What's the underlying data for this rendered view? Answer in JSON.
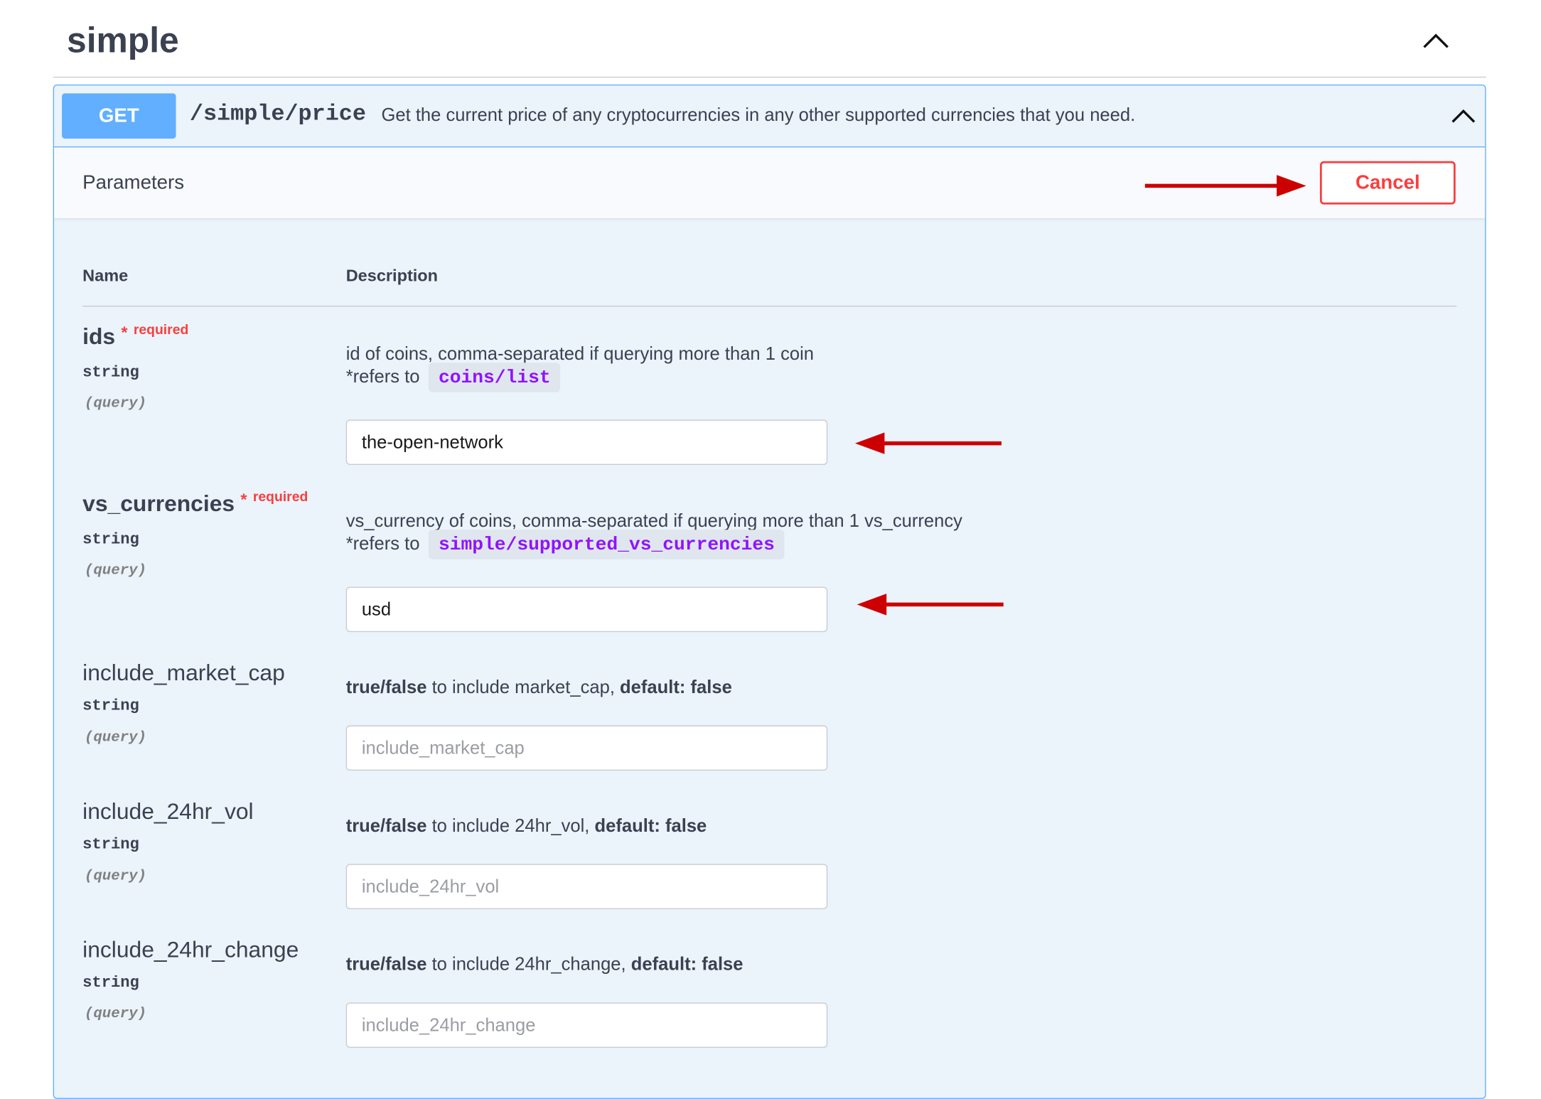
{
  "tag": {
    "title": "simple",
    "toggle_icon": "chevron-up-icon"
  },
  "operation": {
    "method": "GET",
    "path": "/simple/price",
    "summary": "Get the current price of any cryptocurrencies in any other supported currencies that you need.",
    "toggle_icon": "chevron-up-icon",
    "color": "#61affe"
  },
  "parameters_section": {
    "title": "Parameters",
    "cancel_label": "Cancel",
    "cancel_color": "#f93e3e"
  },
  "table": {
    "name_header": "Name",
    "description_header": "Description"
  },
  "params": [
    {
      "name": "ids",
      "required_star": "*",
      "required_label": "required",
      "type": "string",
      "in": "(query)",
      "description": "id of coins, comma-separated if querying more than 1 coin",
      "refers_prefix": "*refers to",
      "refers_link": "coins/list",
      "value": "the-open-network"
    },
    {
      "name": "vs_currencies",
      "required_star": "*",
      "required_label": "required",
      "type": "string",
      "in": "(query)",
      "description": "vs_currency of coins, comma-separated if querying more than 1 vs_currency",
      "refers_prefix": "*refers to",
      "refers_link": "simple/supported_vs_currencies",
      "value": "usd"
    },
    {
      "name": "include_market_cap",
      "type": "string",
      "in": "(query)",
      "desc_bold1": "true/false",
      "desc_mid": " to include market_cap, ",
      "desc_bold2": "default: false",
      "placeholder": "include_market_cap"
    },
    {
      "name": "include_24hr_vol",
      "type": "string",
      "in": "(query)",
      "desc_bold1": "true/false",
      "desc_mid": " to include 24hr_vol, ",
      "desc_bold2": "default: false",
      "placeholder": "include_24hr_vol"
    },
    {
      "name": "include_24hr_change",
      "type": "string",
      "in": "(query)",
      "desc_bold1": "true/false",
      "desc_mid": " to include 24hr_change, ",
      "desc_bold2": "default: false",
      "placeholder": "include_24hr_change"
    }
  ],
  "annotation": {
    "arrow_color": "#cc0000"
  }
}
